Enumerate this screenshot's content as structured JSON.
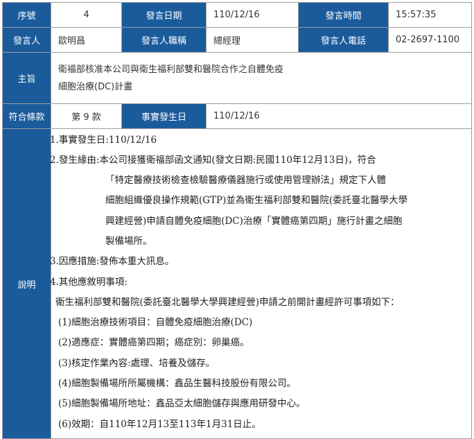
{
  "row1": {
    "seq_label": "序號",
    "seq_value": "4",
    "date_label": "發言日期",
    "date_value": "110/12/16",
    "time_label": "發言時間",
    "time_value": "15:57:35"
  },
  "row2": {
    "speaker_label": "發言人",
    "speaker_value": "歐明昌",
    "title_label": "發言人職稱",
    "title_value": "總經理",
    "phone_label": "發言人電話",
    "phone_value": "02-2697-1100"
  },
  "row3": {
    "subject_label": "主旨",
    "subject_line1": "衛福部核准本公司與衛生福利部雙和醫院合作之自體免疫",
    "subject_line2": "細胞治療(DC)計畫"
  },
  "row4": {
    "clause_label": "符合條款",
    "clause_value": "第 9 款",
    "fact_date_label": "事實發生日",
    "fact_date_value": "110/12/16"
  },
  "row5": {
    "desc_label": "說明",
    "lines": [
      "1.事實發生日:110/12/16",
      "2.發生緣由:本公司接獲衛福部函文通知(發文日期:民國110年12月13日)，符合",
      "「特定醫療技術檢查檢驗醫療儀器施行或使用管理辦法」規定下人體",
      "細胞組織優良操作規範(GTP)並為衛生福利部雙和醫院(委託臺北醫學大學",
      "興建經營)申請自體免疫細胞(DC)治療「實體癌第四期」施行計畫之細胞",
      "製備場所。",
      "3.因應措施:發佈本重大訊息。",
      "4.其他應敘明事項:",
      "衛生福利部雙和醫院(委託臺北醫學大學興建經營)申請之前開計畫經許可事項如下：",
      "(1)細胞治療技術項目：自體免疫細胞治療(DC)",
      "(2)適應症：實體癌第四期；癌症別：卵巢癌。",
      "(3)核定作業內容:處理、培養及儲存。",
      "(4)細胞製備場所所屬機構：鑫品生醫科技股份有限公司。",
      "(5)細胞製備場所地址：鑫品亞太細胞儲存與應用研發中心。",
      "(6)效期：自110年12月13至113年1月31日止。"
    ]
  },
  "colors": {
    "header_bg": "#1a5b9c",
    "header_text": "#ffffff",
    "border": "#9e9e9e"
  }
}
